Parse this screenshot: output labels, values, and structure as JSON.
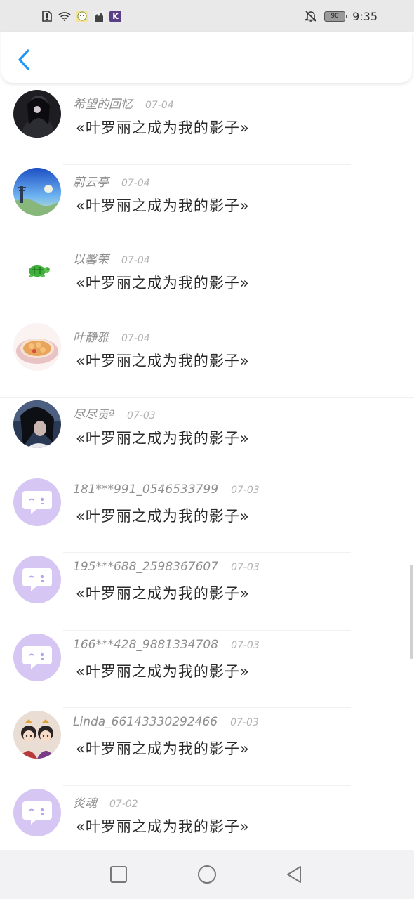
{
  "status": {
    "battery": "90",
    "time": "9:35"
  },
  "messages": [
    {
      "user": "希望的回忆",
      "date": "07-04",
      "text": "«叶罗丽之成为我的影子»",
      "avatar": "photo-dark"
    },
    {
      "user": "蔚云亭",
      "date": "07-04",
      "text": "«叶罗丽之成为我的影子»",
      "avatar": "photo-sky"
    },
    {
      "user": "以馨荣",
      "date": "07-04",
      "text": "«叶罗丽之成为我的影子»",
      "avatar": "turtle"
    },
    {
      "user": "叶静雅",
      "date": "07-04",
      "text": "«叶罗丽之成为我的影子»",
      "avatar": "photo-food"
    },
    {
      "user": "尽尽贡ª",
      "date": "07-03",
      "text": "«叶罗丽之成为我的影子»",
      "avatar": "photo-girl"
    },
    {
      "user": "181***991_0546533799",
      "date": "07-03",
      "text": "«叶罗丽之成为我的影子»",
      "avatar": "default-chat"
    },
    {
      "user": "195***688_2598367607",
      "date": "07-03",
      "text": "«叶罗丽之成为我的影子»",
      "avatar": "default-chat"
    },
    {
      "user": "166***428_9881334708",
      "date": "07-03",
      "text": "«叶罗丽之成为我的影子»",
      "avatar": "default-chat"
    },
    {
      "user": "Linda_66143330292466",
      "date": "07-03",
      "text": "«叶罗丽之成为我的影子»",
      "avatar": "photo-dolls"
    },
    {
      "user": "炎魂",
      "date": "07-02",
      "text": "«叶罗丽之成为我的影子»",
      "avatar": "default-chat"
    }
  ],
  "colors": {
    "accent": "#2196f3",
    "default_avatar": "#d6c6f3"
  }
}
